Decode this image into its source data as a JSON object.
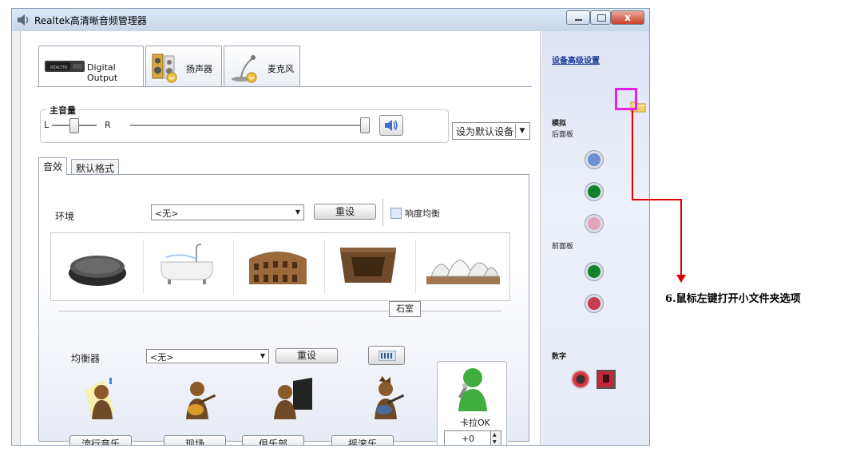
{
  "window": {
    "title": "Realtek高清晰音频管理器",
    "close_label": "x"
  },
  "device_tabs": [
    {
      "label": "Digital Output",
      "icon": "digital-output-device-icon"
    },
    {
      "label": "扬声器",
      "icon": "speaker-icon"
    },
    {
      "label": "麦克风",
      "icon": "microphone-icon"
    }
  ],
  "volume": {
    "group_label": "主音量",
    "left_label": "L",
    "right_label": "R",
    "balance_value": 0.5,
    "volume_value": 1.0,
    "default_device_label": "设为默认设备"
  },
  "sub_tabs": [
    "音效",
    "默认格式"
  ],
  "environment": {
    "label": "环境",
    "value": "<无>",
    "reset_label": "重设",
    "loudness_label": "响度均衡",
    "loudness_checked": false,
    "presets": [
      "disc-environment-icon",
      "bathtub-environment-icon",
      "colosseum-environment-icon",
      "stone-room-environment-icon",
      "opera-house-environment-icon"
    ],
    "tooltip": "石室"
  },
  "equalizer": {
    "label": "均衡器",
    "value": "<无>",
    "reset_label": "重设",
    "presets": [
      "流行音乐",
      "现场",
      "俱乐部",
      "摇滚乐"
    ]
  },
  "karaoke": {
    "label": "卡拉OK",
    "value": "+0"
  },
  "right_panel": {
    "advanced_link": "设备高级设置",
    "analog_label": "模拟",
    "back_panel_label": "后面板",
    "front_panel_label": "前面板",
    "digital_label": "数字",
    "colors": {
      "back_blue": "#6f8fd0",
      "back_green": "#13802a",
      "back_pink": "#e0a6b8",
      "front_green": "#13802a",
      "front_red": "#c83a4e"
    }
  },
  "annotation": {
    "text": "6.鼠标左键打开小文件夹选项",
    "color": "#e620e6",
    "arrow_color": "#e00000"
  }
}
